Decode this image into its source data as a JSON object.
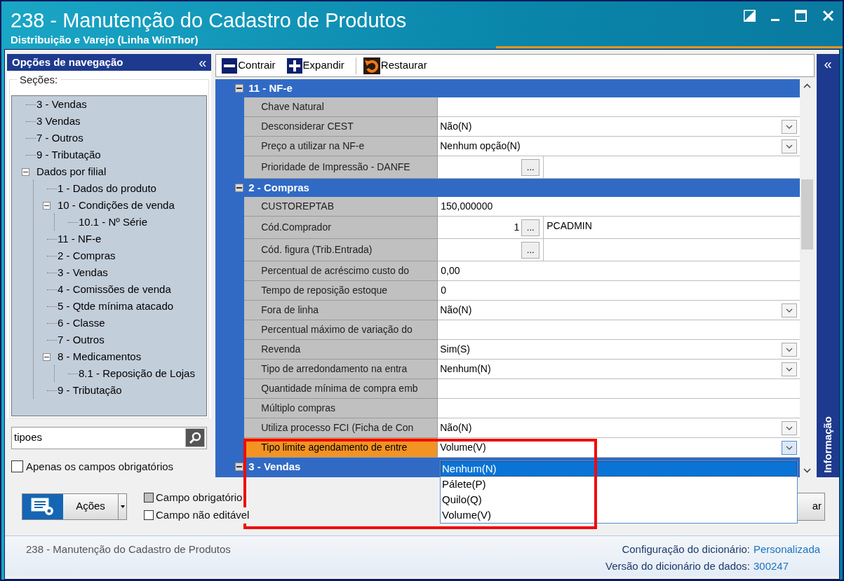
{
  "window": {
    "title": "238 - Manutenção do Cadastro de Produtos",
    "subtitle": "Distribuição e Varejo (Linha WinThor)"
  },
  "navigation": {
    "title": "Opções de navegação",
    "collapse": "«",
    "sections_label": "Seções:",
    "tree": [
      {
        "label": "3 - Vendas"
      },
      {
        "label": "3 Vendas"
      },
      {
        "label": "7 - Outros"
      },
      {
        "label": "9 - Tributação"
      },
      {
        "label": "Dados por filial",
        "expanded": true,
        "children": [
          {
            "label": "1 - Dados do produto"
          },
          {
            "label": "10 - Condições de venda",
            "expanded": true,
            "children": [
              {
                "label": "10.1 - Nº Série"
              }
            ]
          },
          {
            "label": "11 - NF-e"
          },
          {
            "label": "2 - Compras"
          },
          {
            "label": "3 - Vendas"
          },
          {
            "label": "4 - Comissões de venda"
          },
          {
            "label": "5 - Qtde mínima atacado"
          },
          {
            "label": "6 - Classe"
          },
          {
            "label": "7 - Outros"
          },
          {
            "label": "8 - Medicamentos",
            "expanded": true,
            "children": [
              {
                "label": "8.1 -  Reposição de Lojas"
              }
            ]
          },
          {
            "label": "9 - Tributação"
          }
        ]
      }
    ],
    "search": {
      "value": "tipoes"
    },
    "required_only": {
      "label": "Apenas os campos obrigatórios",
      "checked": false
    }
  },
  "toolbar": [
    {
      "kind": "collapse",
      "label": "Contrair"
    },
    {
      "kind": "expand",
      "label": "Expandir"
    },
    {
      "kind": "restore",
      "label": "Restaurar"
    }
  ],
  "groups": [
    {
      "title": "11 - NF-e",
      "expanded": true,
      "rows": [
        {
          "kind": "text",
          "label": "Chave Natural",
          "value": "",
          "selected": false
        },
        {
          "kind": "combo",
          "label": "Desconsiderar CEST",
          "value": "Não(N)",
          "selected": false
        },
        {
          "kind": "combo",
          "label": "Preço a utilizar na NF-e",
          "value": "Nenhum opção(N)",
          "selected": false
        },
        {
          "kind": "lookup",
          "label": "Prioridade de Impressão - DANFE",
          "value": "",
          "button": "...",
          "extra": "",
          "selected": false
        }
      ]
    },
    {
      "title": "2 - Compras",
      "expanded": true,
      "rows": [
        {
          "kind": "text",
          "label": "CUSTOREPTAB",
          "value": "150,000000",
          "selected": false
        },
        {
          "kind": "lookup",
          "label": "Cód.Comprador",
          "value": "1",
          "button": "...",
          "extra": "PCADMIN",
          "selected": false
        },
        {
          "kind": "lookup",
          "label": "Cód. figura (Trib.Entrada)",
          "value": "",
          "button": "...",
          "extra": "",
          "selected": false
        },
        {
          "kind": "text",
          "label": "Percentual de acréscimo custo do",
          "value": "0,00",
          "selected": false
        },
        {
          "kind": "text",
          "label": "Tempo de reposição estoque",
          "value": "0",
          "selected": false
        },
        {
          "kind": "combo",
          "label": "Fora de linha",
          "value": "Não(N)",
          "selected": false
        },
        {
          "kind": "text",
          "label": "Percentual máximo de variação do",
          "value": "",
          "selected": false
        },
        {
          "kind": "combo",
          "label": "Revenda",
          "value": "Sim(S)",
          "selected": false
        },
        {
          "kind": "combo",
          "label": "Tipo de arredondamento na entra",
          "value": "Nenhum(N)",
          "selected": false
        },
        {
          "kind": "text",
          "label": "Quantidade mínima de compra emb",
          "value": "",
          "selected": false
        },
        {
          "kind": "text",
          "label": "Múltiplo compras",
          "value": "",
          "selected": false
        },
        {
          "kind": "combo",
          "label": "Utiliza processo FCI (Ficha de Con",
          "value": "Não(N)",
          "selected": false
        },
        {
          "kind": "combo",
          "label": "Tipo limite agendamento de entre",
          "value": "Volume(V)",
          "selected": true
        }
      ]
    },
    {
      "title": "3 - Vendas",
      "expanded": true
    }
  ],
  "dropdown": {
    "options": [
      {
        "label": "Nenhum(N)",
        "selected": true
      },
      {
        "label": "Pálete(P)",
        "selected": false
      },
      {
        "label": "Quilo(Q)",
        "selected": false
      },
      {
        "label": "Volume(V)",
        "selected": false
      }
    ]
  },
  "info_panel": {
    "collapse": "«",
    "title": "Informação"
  },
  "actions_button": {
    "label": "Ações"
  },
  "legend": [
    {
      "kind": "required",
      "label": "Campo obrigatório"
    },
    {
      "kind": "readonly",
      "label": "Campo não editável"
    }
  ],
  "covered_button": {
    "label": "ar"
  },
  "status_bar": {
    "text": "238 - Manutenção do Cadastro de Produtos",
    "items": [
      {
        "label": "Configuração do dicionário:",
        "value": "Personalizada"
      },
      {
        "label": "Versão do dicionário de dados:",
        "value": "300247"
      }
    ]
  }
}
